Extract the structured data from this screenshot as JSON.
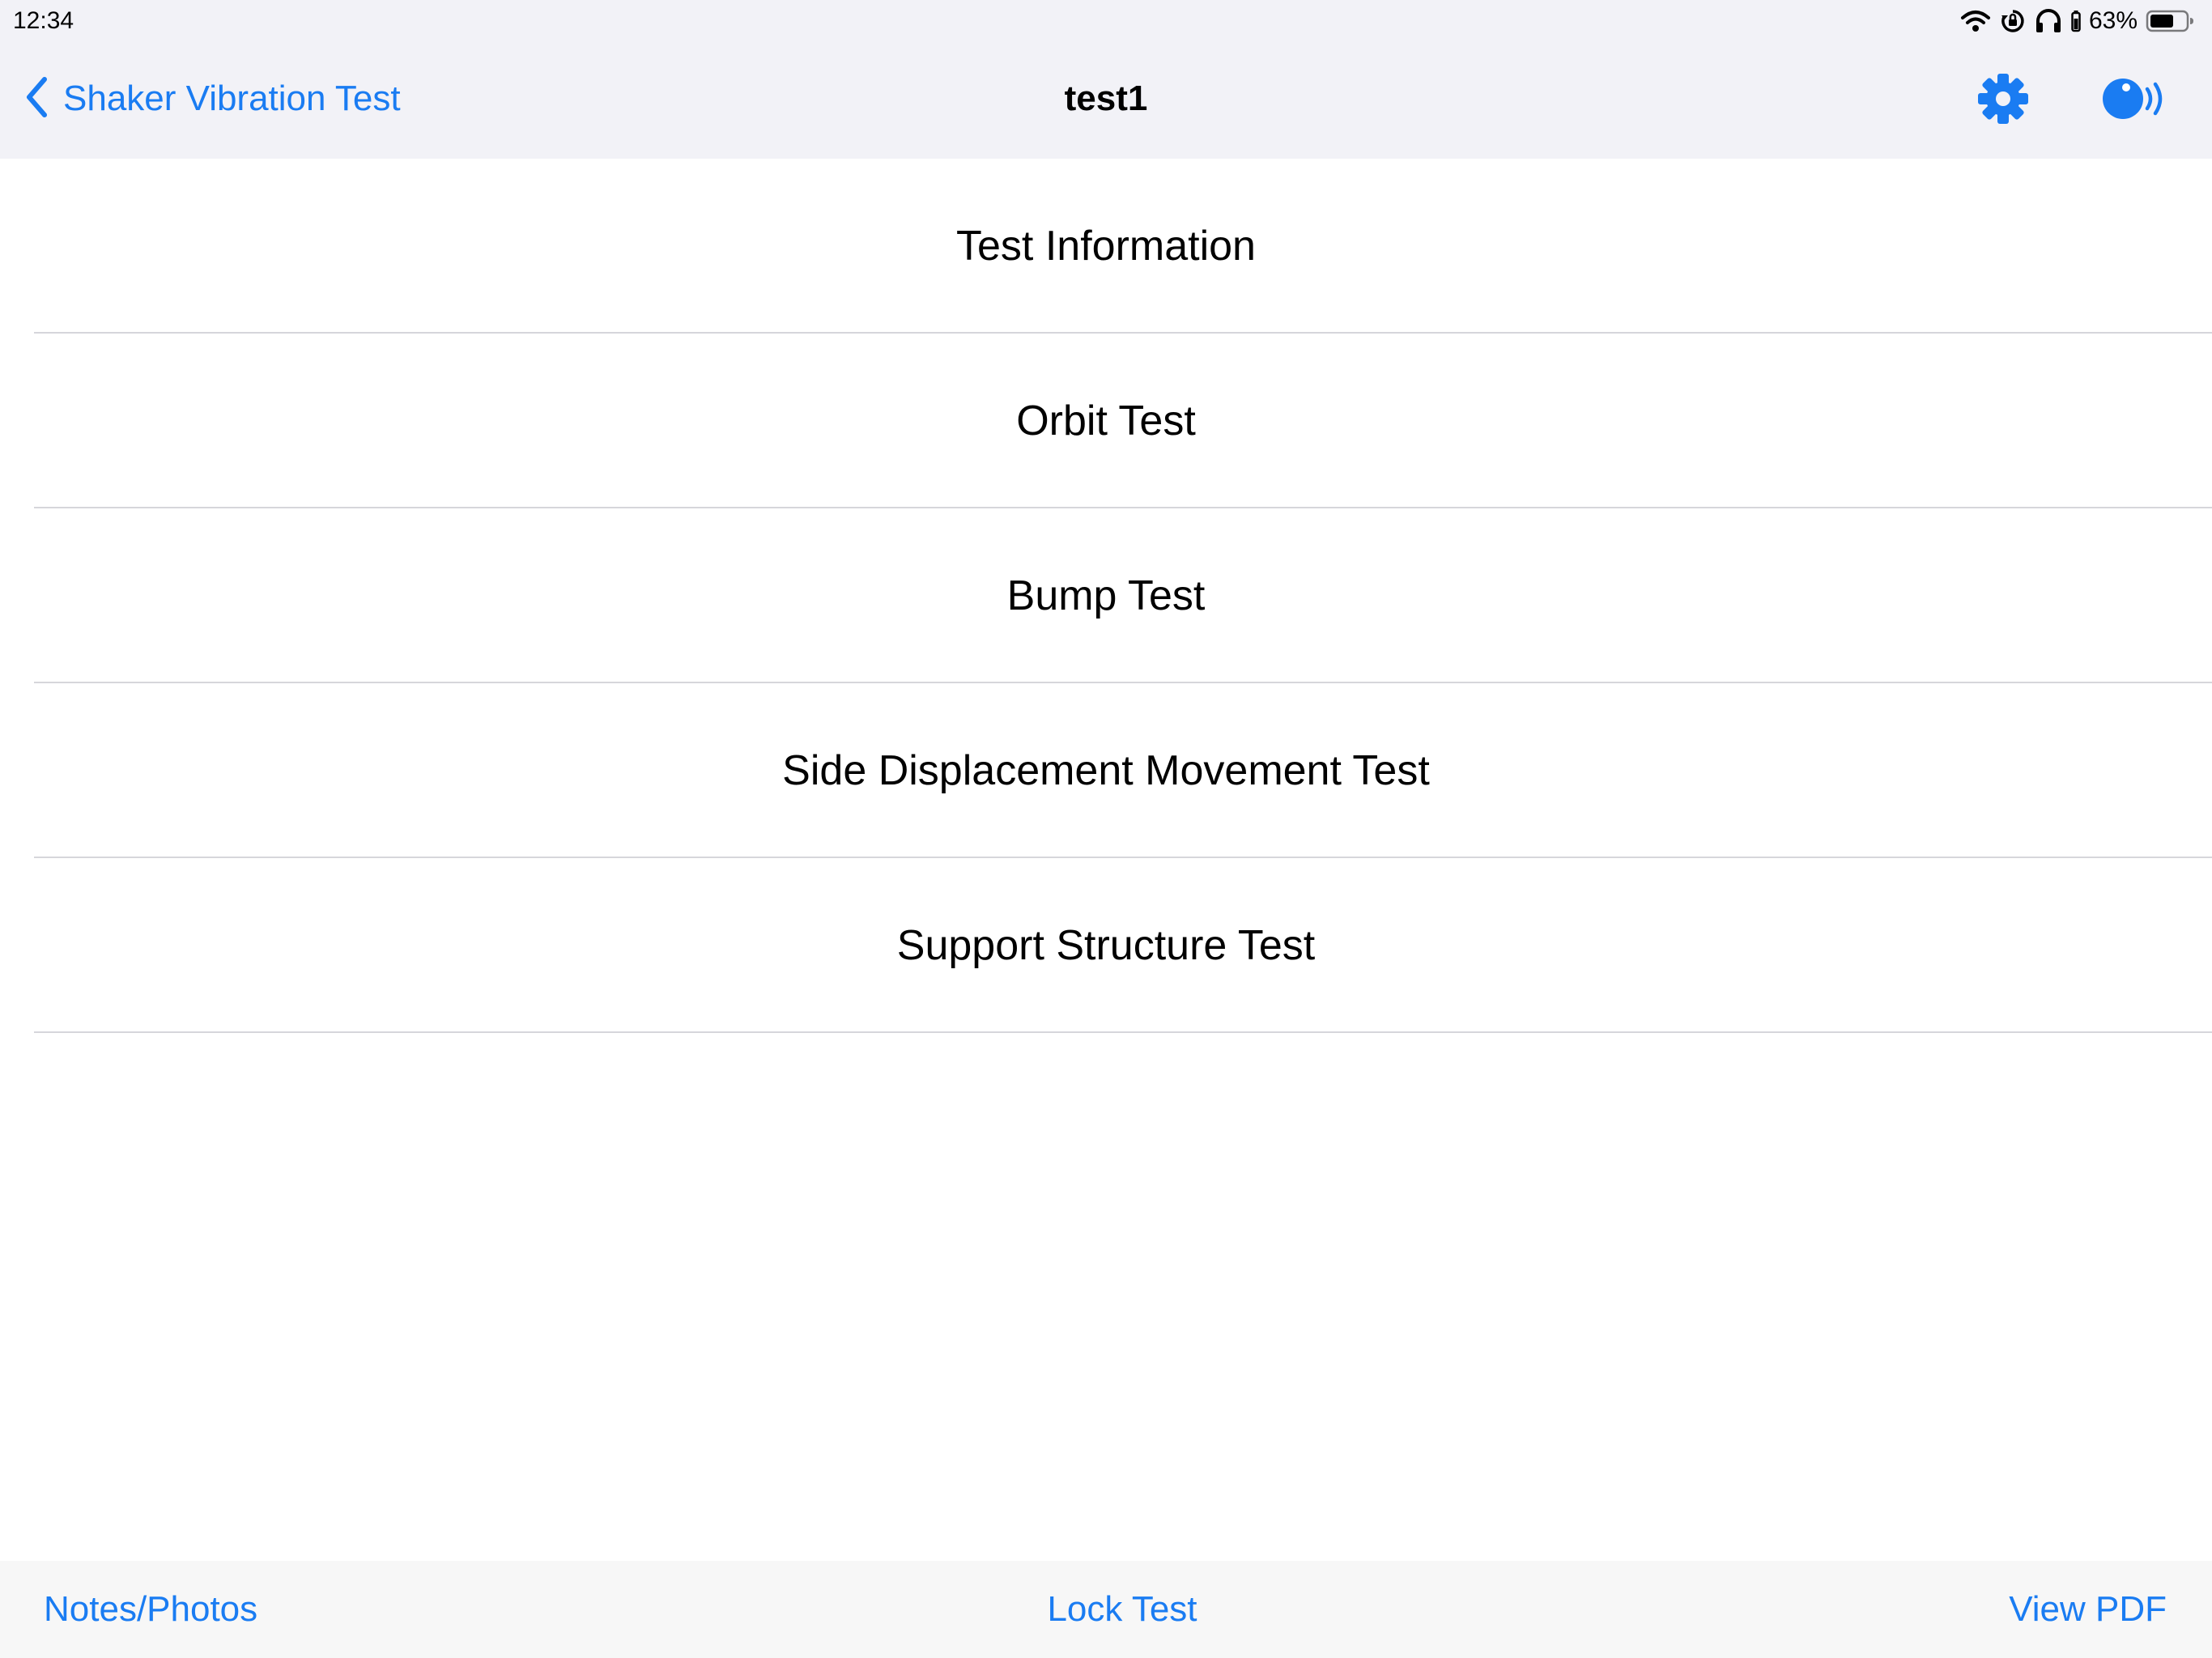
{
  "status_bar": {
    "time": "12:34",
    "battery_percent": "63%",
    "icons": [
      "wifi-icon",
      "orientation-lock-icon",
      "headphones-icon",
      "battery-icon"
    ]
  },
  "nav": {
    "back_label": "Shaker Vibration Test",
    "title": "test1",
    "back_icon": "chevron-left-icon",
    "settings_icon": "gear-icon",
    "sensor_icon": "sensor-signal-icon",
    "accent_color": "#1a7cf2"
  },
  "list": {
    "items": [
      {
        "label": "Test Information"
      },
      {
        "label": "Orbit Test"
      },
      {
        "label": "Bump Test"
      },
      {
        "label": "Side Displacement Movement Test"
      },
      {
        "label": "Support Structure Test"
      }
    ]
  },
  "toolbar": {
    "notes_label": "Notes/Photos",
    "lock_label": "Lock Test",
    "pdf_label": "View PDF"
  }
}
